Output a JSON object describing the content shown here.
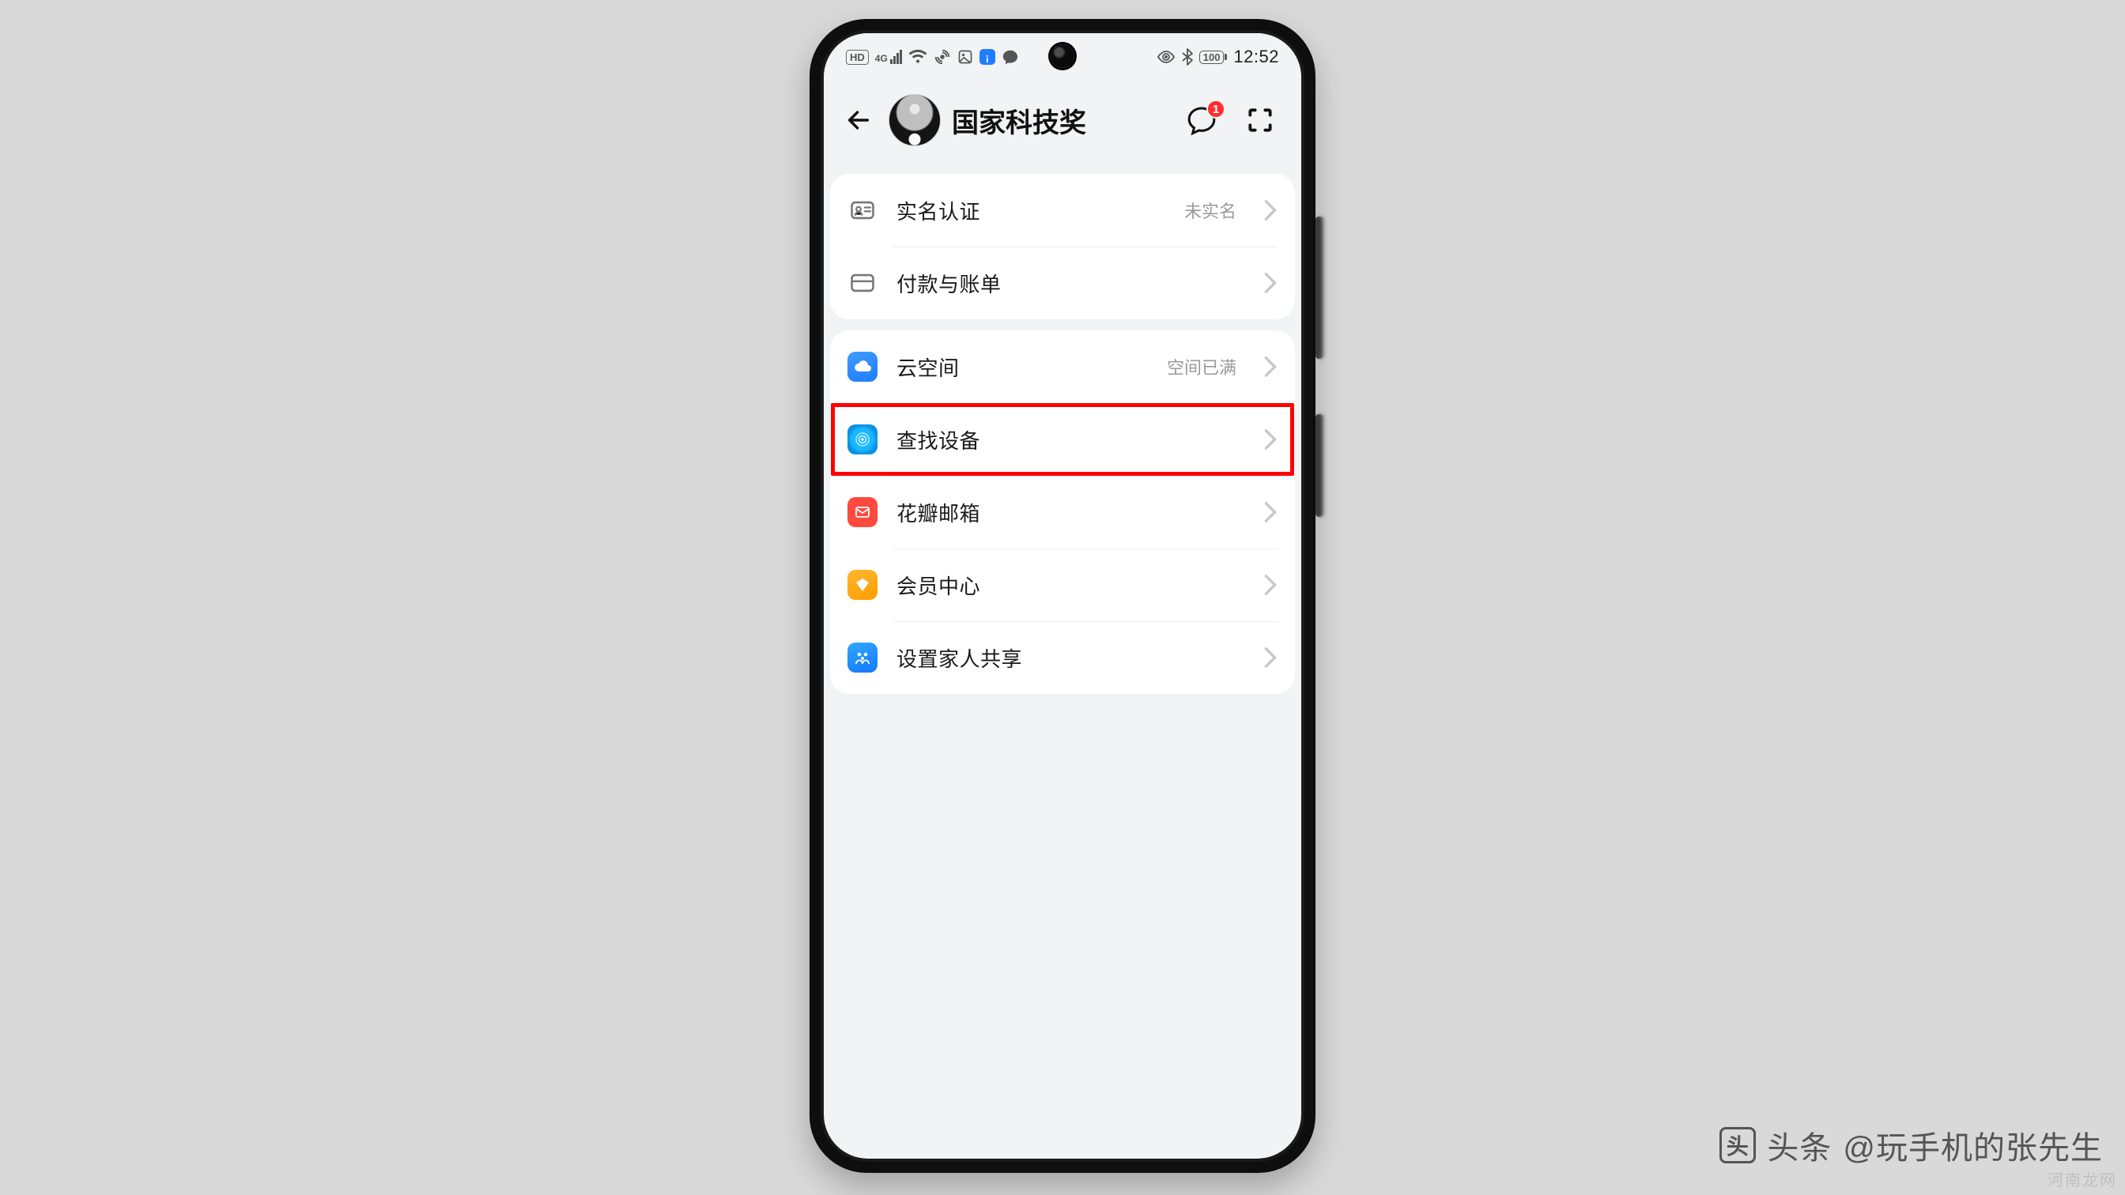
{
  "status": {
    "hd": "HD",
    "net": "4G",
    "battery": "100",
    "time": "12:52"
  },
  "header": {
    "title": "国家科技奖",
    "notif_count": "1"
  },
  "group1": {
    "realname": {
      "label": "实名认证",
      "trail": "未实名"
    },
    "billing": {
      "label": "付款与账单"
    }
  },
  "group2": {
    "cloud": {
      "label": "云空间",
      "trail": "空间已满"
    },
    "find": {
      "label": "查找设备"
    },
    "mail": {
      "label": "花瓣邮箱"
    },
    "member": {
      "label": "会员中心"
    },
    "family": {
      "label": "设置家人共享"
    }
  },
  "watermark": {
    "source": "头条",
    "author": "@玩手机的张先生",
    "site": "河南龙网"
  }
}
